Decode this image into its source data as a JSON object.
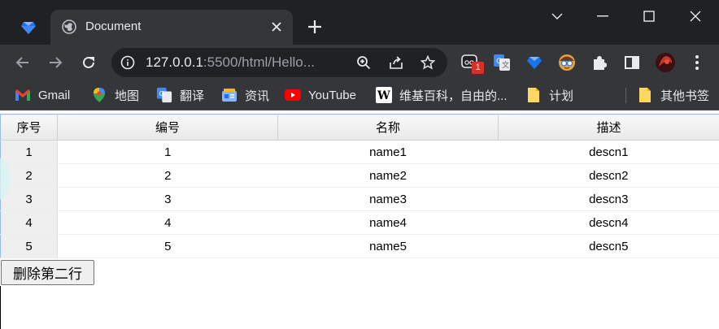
{
  "browser": {
    "tab": {
      "title": "Document"
    },
    "address": {
      "host": "127.0.0.1",
      "rest": ":5500/html/Hello..."
    },
    "extensions_badge": "1",
    "bookmarks": [
      {
        "label": "Gmail",
        "icon": "gmail-icon"
      },
      {
        "label": "地图",
        "icon": "maps-icon"
      },
      {
        "label": "翻译",
        "icon": "translate-icon"
      },
      {
        "label": "资讯",
        "icon": "news-icon"
      },
      {
        "label": "YouTube",
        "icon": "youtube-icon"
      },
      {
        "label": "维基百科，自由的...",
        "icon": "wikipedia-icon"
      },
      {
        "label": "计划",
        "icon": "folder-icon"
      },
      {
        "label": "其他书签",
        "icon": "folder-icon"
      }
    ]
  },
  "grid": {
    "columns": [
      "序号",
      "编号",
      "名称",
      "描述"
    ],
    "rows": [
      [
        "1",
        "1",
        "name1",
        "descn1"
      ],
      [
        "2",
        "2",
        "name2",
        "descn2"
      ],
      [
        "3",
        "3",
        "name3",
        "descn3"
      ],
      [
        "4",
        "4",
        "name4",
        "descn4"
      ],
      [
        "5",
        "5",
        "name5",
        "descn5"
      ]
    ]
  },
  "actions": {
    "delete_label": "删除第二行"
  },
  "colors": {
    "chrome_dark": "#202124",
    "chrome_toolbar": "#35363a",
    "grid_border": "#99bbe8"
  }
}
